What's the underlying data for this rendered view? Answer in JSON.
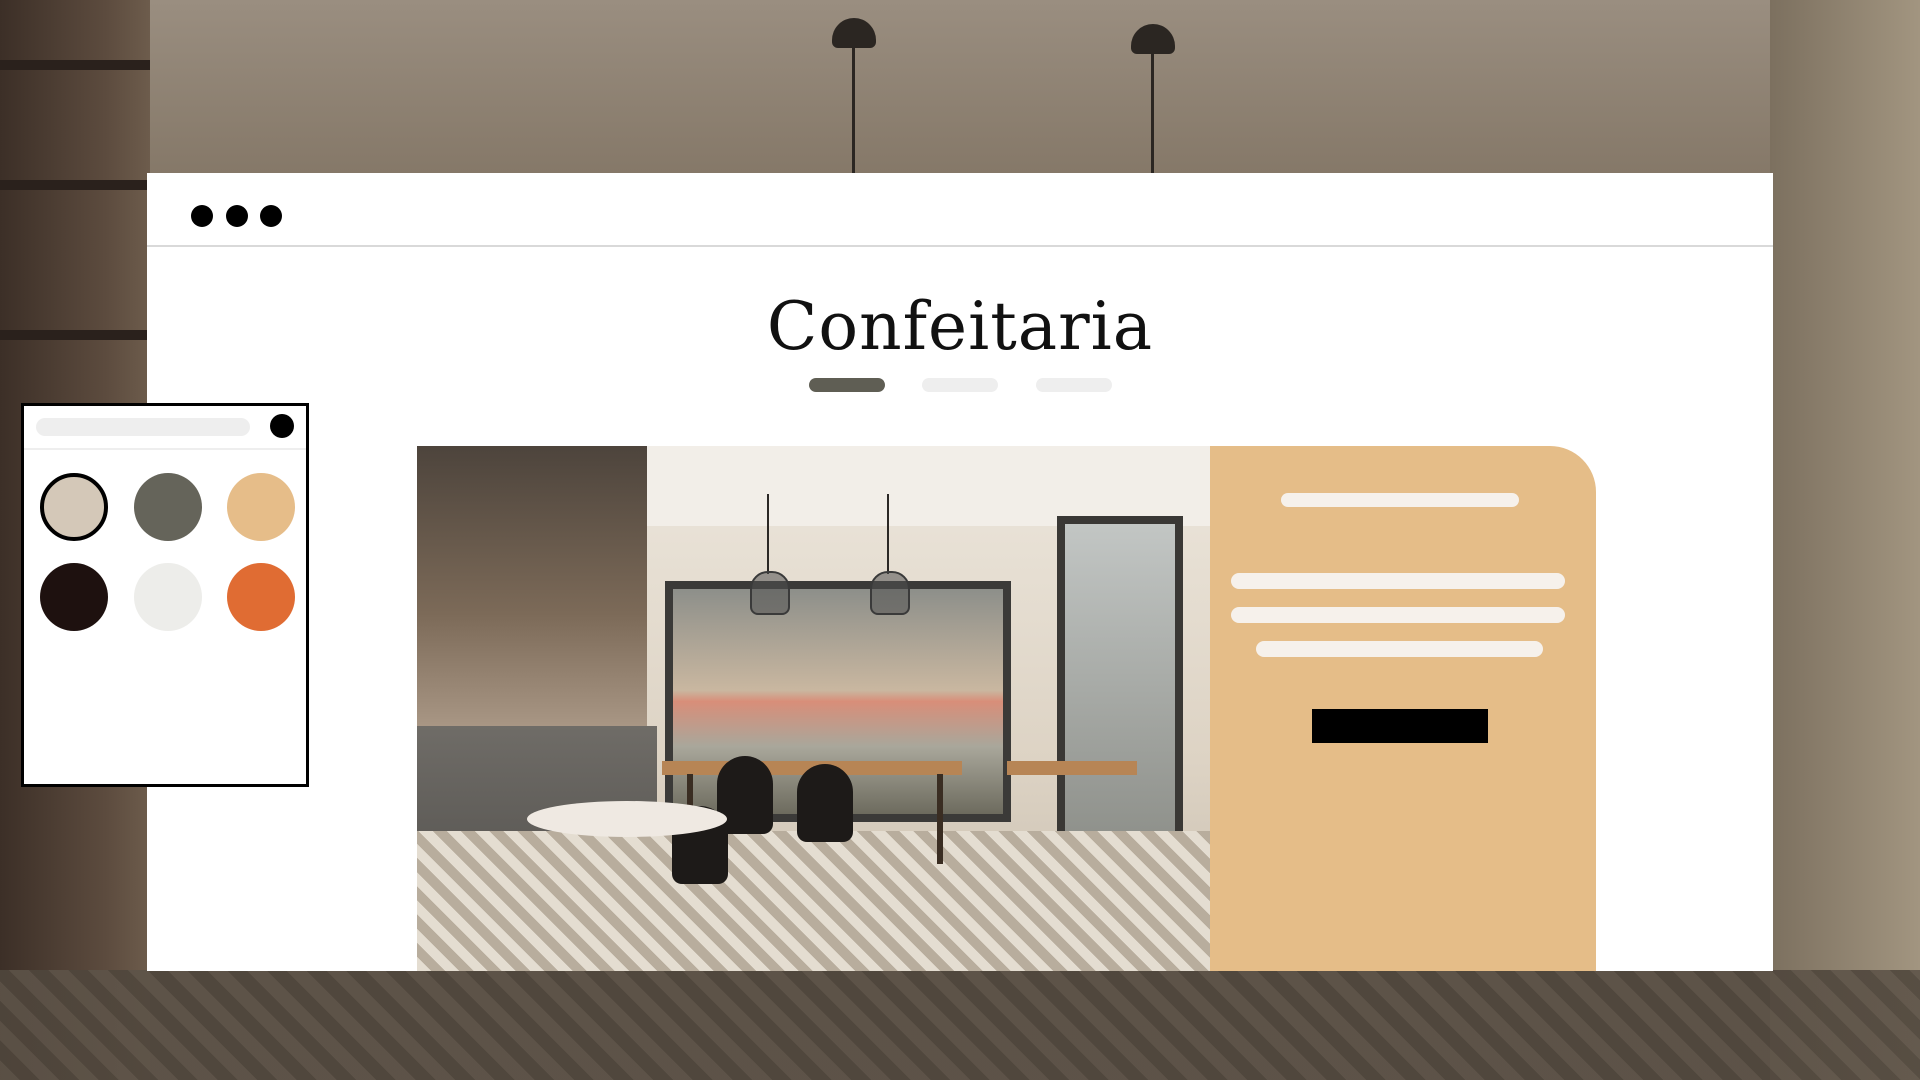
{
  "page": {
    "title": "Confeitaria",
    "nav_tabs": [
      {
        "state": "active",
        "color": "#5f5e54"
      },
      {
        "state": "inactive",
        "color": "#eeeeee"
      },
      {
        "state": "inactive",
        "color": "#eeeeee"
      }
    ],
    "hero_image": "cafe-interior-photo"
  },
  "window": {
    "controls": [
      "window-dot",
      "window-dot",
      "window-dot"
    ],
    "colors": {
      "background": "#ffffff",
      "divider": "#d9d9d9"
    }
  },
  "side_card": {
    "color": "#e5bd88",
    "text_placeholder_color": "#f6f1eb",
    "cta_color": "#000000"
  },
  "palette": {
    "selected_index": 0,
    "swatches": [
      {
        "color": "#d4c8b8",
        "name": "beige"
      },
      {
        "color": "#65645a",
        "name": "olive-gray"
      },
      {
        "color": "#e6bd89",
        "name": "tan"
      },
      {
        "color": "#1e110f",
        "name": "espresso"
      },
      {
        "color": "#ededea",
        "name": "off-white"
      },
      {
        "color": "#e06c33",
        "name": "orange"
      }
    ]
  }
}
